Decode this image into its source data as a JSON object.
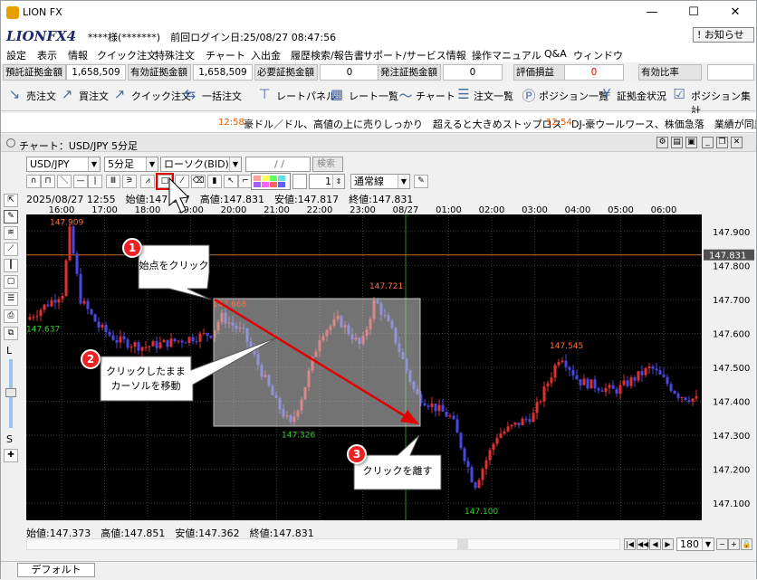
{
  "app": {
    "title": "LION FX",
    "logo": "LIONFX4",
    "user_text": "****様(*******)　前回ログイン日:25/08/27 08:47:56",
    "notice": "! お知らせ",
    "win_min": "—",
    "win_max": "☐",
    "win_close": "✕"
  },
  "menu": [
    "設定",
    "表示",
    "情報",
    "クイック注文",
    "特殊注文",
    "チャート",
    "入出金",
    "履歴検索/報告書",
    "サポート/サービス情報",
    "操作マニュアル",
    "Q&A",
    "ウィンドウ"
  ],
  "account": {
    "fields": [
      {
        "label": "預託証拠金額",
        "value": "1,658,509"
      },
      {
        "label": "有効証拠金額",
        "value": "1,658,509"
      },
      {
        "label": "必要証拠金額",
        "value": "0"
      },
      {
        "label": "発注証拠金額",
        "value": "0"
      },
      {
        "label": "評価損益",
        "value": "0",
        "color": "#e00000"
      },
      {
        "label": "有効比率",
        "value": ""
      }
    ]
  },
  "toolbar": [
    "売注文",
    "買注文",
    "クイック注文",
    "一括注文",
    "レートパネル",
    "レート一覧",
    "チャート",
    "注文一覧",
    "ポジション一覧",
    "証拠金状況",
    "ポジション集計"
  ],
  "ticker": [
    {
      "time": "12:58",
      "text": "豪ドル／ドル、高値の上に売りしっかり　超えると大きめストップロス"
    },
    {
      "time": "12:54",
      "text": "DJ-豪ウールワース、株価急落　業績が同業コー"
    }
  ],
  "chart_window": {
    "title": "チャート：USD/JPY 5分足"
  },
  "controls": {
    "pair": "USD/JPY",
    "period": "5分足",
    "candle": "ローソク(BID)",
    "date": "/ /",
    "search": "検索",
    "line_width": "1",
    "line_type": "通常線"
  },
  "colors": {
    "bg": "#000000",
    "up": "#e03030",
    "down": "#4848e0",
    "accent": "#e00000",
    "price_line": "#c07020"
  },
  "info_top": "2025/08/27 12:55　始値:147.817　高値:147.831　安値:147.817　終値:147.831",
  "info_bottom": "始値:147.373　高値:147.851　安値:147.362　終値:147.831",
  "zoom": "180",
  "tab": "デフォルト",
  "lefttool_L": "L",
  "lefttool_S": "S",
  "chart_data": {
    "type": "candlestick",
    "x_ticks": [
      "16:00",
      "17:00",
      "18:00",
      "19:00",
      "20:00",
      "21:00",
      "22:00",
      "23:00",
      "08/27",
      "01:00",
      "02:00",
      "03:00",
      "04:00",
      "05:00",
      "06:00"
    ],
    "y_ticks": [
      "147.900",
      "147.800",
      "147.700",
      "147.600",
      "147.500",
      "147.400",
      "147.300",
      "147.200",
      "147.100"
    ],
    "ylim": [
      147.05,
      147.95
    ],
    "current_price": "147.831",
    "annotations": [
      {
        "text": "147.909",
        "price": 147.909,
        "color": "#ff7040"
      },
      {
        "text": "147.637",
        "price": 147.637,
        "color": "#30d030"
      },
      {
        "text": "147.668",
        "price": 147.668,
        "color": "#ff7040"
      },
      {
        "text": "147.721",
        "price": 147.721,
        "color": "#ff7040"
      },
      {
        "text": "147.326",
        "price": 147.326,
        "color": "#30d030"
      },
      {
        "text": "147.545",
        "price": 147.545,
        "color": "#ff7040"
      },
      {
        "text": "147.100",
        "price": 147.1,
        "color": "#30d030"
      }
    ]
  },
  "callouts": [
    {
      "num": "1",
      "text": "始点をクリック"
    },
    {
      "num": "2",
      "text": "クリックしたまま\nカーソルを移動"
    },
    {
      "num": "3",
      "text": "クリックを離す"
    }
  ]
}
